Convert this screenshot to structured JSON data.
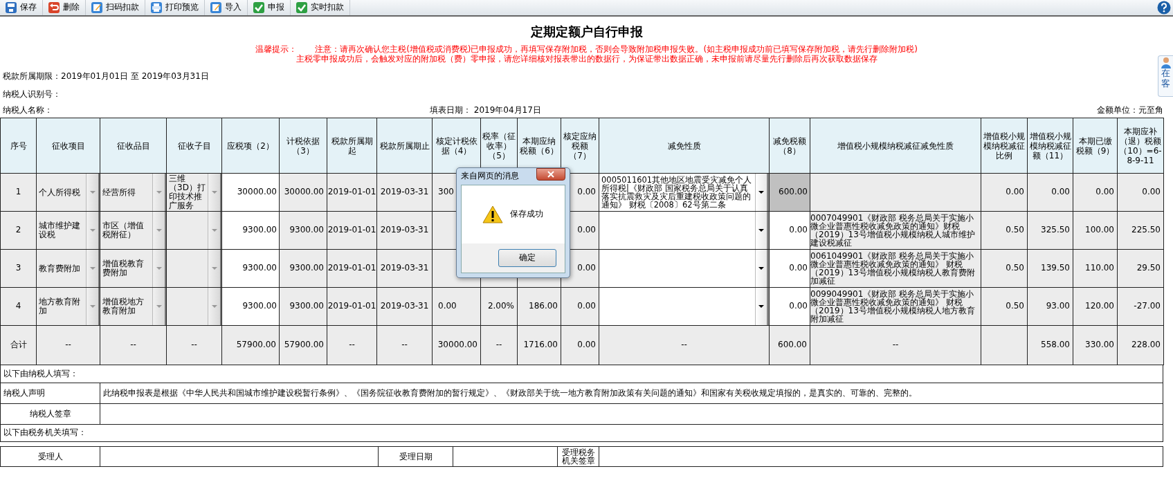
{
  "toolbar": [
    {
      "label": "保存",
      "kind": "save"
    },
    {
      "label": "删除",
      "kind": "delete"
    },
    {
      "label": "扫码扣款",
      "kind": "edit"
    },
    {
      "label": "打印预览",
      "kind": "print"
    },
    {
      "label": "导入",
      "kind": "edit"
    },
    {
      "label": "申报",
      "kind": "check"
    },
    {
      "label": "实时扣款",
      "kind": "check"
    }
  ],
  "title": "定期定额户自行申报",
  "notice": {
    "label": "温馨提示：",
    "lines": [
      "注意：请再次确认您主税(增值税或消费税)已申报成功，再填写保存附加税，否则会导致附加税申报失败。(如主税申报成功前已填写保存附加税，请先行删除附加税)",
      "主税零申报成功后，会触发对应的附加税（费）零申报，请您详细核对报表带出的数据行，为保证带出数据正确，未申报前请尽量先行删除后再次获取数据保存"
    ]
  },
  "info": {
    "period": "税款所属期限：2019年01月01日 至 2019年03月31日",
    "taxpayer_id": "纳税人识别号：",
    "taxpayer_name": "纳税人名称：",
    "fill_date": "填表日期： 2019年04月17日",
    "unit": "金额单位：元至角"
  },
  "side_widget": {
    "lines": [
      "在",
      "客"
    ]
  },
  "table": {
    "columns": [
      {
        "label": "序号",
        "kind": "seq"
      },
      {
        "label": "征收项目",
        "kind": "select"
      },
      {
        "label": "征收品目",
        "kind": "select"
      },
      {
        "label": "征收子目",
        "kind": "select"
      },
      {
        "label": "应税项（2）",
        "kind": "input"
      },
      {
        "label": "计税依据（3）",
        "kind": "num"
      },
      {
        "label": "税款所属期起",
        "kind": "date"
      },
      {
        "label": "税款所属期止",
        "kind": "date"
      },
      {
        "label": "核定计税依据（4）",
        "kind": "num"
      },
      {
        "label": "税率（征收率）（5）",
        "kind": "num"
      },
      {
        "label": "本期应纳税额（6）",
        "kind": "num"
      },
      {
        "label": "核定应纳税额（7）",
        "kind": "num"
      },
      {
        "label": "减免性质",
        "kind": "relief_select"
      },
      {
        "label": "减免税额（8）",
        "kind": "input"
      },
      {
        "label": "增值税小规模纳税减征减免性质",
        "kind": "note"
      },
      {
        "label": "增值税小规模纳税减征比例",
        "kind": "num"
      },
      {
        "label": "增值税小规模纳税减征额（11）",
        "kind": "num"
      },
      {
        "label": "本期已缴税额（9）",
        "kind": "num"
      },
      {
        "label": "本期应补（退）税额（10）=6-8-9-11",
        "kind": "num"
      }
    ],
    "rows": [
      {
        "locked_relief": true,
        "cells": [
          "1",
          "个人所得税",
          "经营所得",
          "三维（3D）打印技术推广服务",
          "30000.00",
          "30000.00",
          "2019-01-01",
          "2019-03-31",
          "300",
          null,
          null,
          "0.00",
          "0005011601其他地区地震受灾减免个人所得税|《财政部 国家税务总局关于认真落实抗震救灾及灾后重建税收政策问题的通知》 财税〔2008〕62号第二条",
          "600.00",
          null,
          "0.00",
          "0.00",
          "0.00",
          "0.00"
        ]
      },
      {
        "locked_relief": false,
        "cells": [
          "2",
          "城市维护建设税",
          "市区（增值税附征）",
          null,
          "9300.00",
          "9300.00",
          "2019-01-01",
          "2019-03-31",
          null,
          null,
          null,
          "0.00",
          null,
          "0.00",
          "0007049901《财政部 税务总局关于实施小微企业普惠性税收减免政策的通知》财税（2019）13号增值税小规模纳税人城市维护建设税减征",
          "0.50",
          "325.50",
          "100.00",
          "225.50"
        ]
      },
      {
        "locked_relief": false,
        "cells": [
          "3",
          "教育费附加",
          "增值税教育费附加",
          null,
          "9300.00",
          "9300.00",
          "2019-01-01",
          "2019-03-31",
          null,
          null,
          null,
          "0.00",
          null,
          "0.00",
          "0061049901《财政部 税务总局关于实施小微企业普惠性税收减免政策的通知》 财税（2019）13号增值税小规模纳税人教育费附加减征",
          "0.50",
          "139.50",
          "110.00",
          "29.50"
        ]
      },
      {
        "locked_relief": false,
        "cells": [
          "4",
          "地方教育附加",
          "增值税地方教育附加",
          null,
          "9300.00",
          "9300.00",
          "2019-01-01",
          "2019-03-31",
          "0.00",
          "2.00%",
          "186.00",
          "0.00",
          null,
          "0.00",
          "0099049901《财政部 税务总局关于实施小微企业普惠性税收减免政策的通知》 财税（2019）13号增值税小规模纳税人地方教育附加减征",
          "0.50",
          "93.00",
          "120.00",
          "-27.00"
        ]
      }
    ],
    "total": [
      {
        "kind": "label",
        "text": "合计"
      },
      {
        "kind": "dash",
        "text": "--"
      },
      {
        "kind": "dash",
        "text": "--"
      },
      {
        "kind": "dash",
        "text": "--"
      },
      {
        "kind": "amount",
        "text": "57900.00"
      },
      {
        "kind": "amount",
        "text": "57900.00"
      },
      {
        "kind": "dash",
        "text": "--"
      },
      {
        "kind": "dash",
        "text": "--"
      },
      {
        "kind": "amount",
        "text": "30000.00"
      },
      {
        "kind": "dash",
        "text": "--"
      },
      {
        "kind": "amount",
        "text": "1716.00"
      },
      {
        "kind": "amount",
        "text": "0.00"
      },
      {
        "kind": "dash",
        "text": "--"
      },
      {
        "kind": "amount",
        "text": "600.00"
      },
      {
        "kind": "dash",
        "text": "--"
      },
      {
        "kind": "blank"
      },
      {
        "kind": "amount",
        "text": "558.00"
      },
      {
        "kind": "amount",
        "text": "330.00"
      },
      {
        "kind": "amount",
        "text": "228.00"
      }
    ]
  },
  "taxpayer_section": {
    "heading": "以下由纳税人填写：",
    "declaration_label": "纳税人声明",
    "declaration": "此纳税申报表是根据《中华人民共和国城市维护建设税暂行条例》、《国务院征收教育费附加的暂行规定》、《财政部关于统一地方教育附加政策有关问题的通知》和国家有关税收规定填报的，是真实的、可靠的、完整的。",
    "signature_label": "纳税人签章"
  },
  "authority_section": {
    "heading": "以下由税务机关填写：",
    "fields": [
      "受理人",
      "受理日期",
      "受理税务机关签章"
    ]
  },
  "dialog": {
    "title": "来自网页的消息",
    "message": "保存成功",
    "button": "确定"
  }
}
